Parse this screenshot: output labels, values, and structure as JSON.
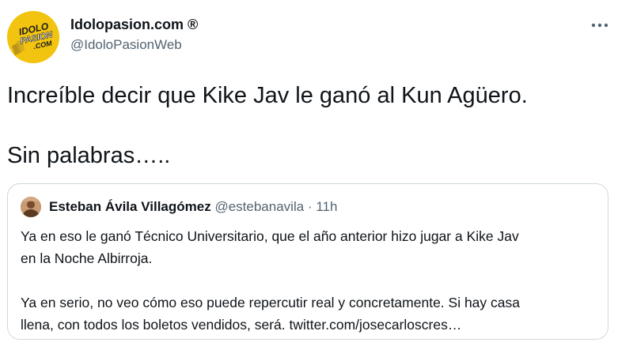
{
  "author": {
    "display_name": "Idolopasion.com ®",
    "handle": "@IdoloPasionWeb",
    "avatar_icon": "idolopasion-logo-icon",
    "avatar_logo_lines": [
      "IDOLO",
      "PASION",
      ".COM"
    ]
  },
  "more_icon": "more-horizontal-icon",
  "tweet": {
    "line1": "Increíble decir que Kike Jav le ganó al Kun Agüero.",
    "line2": "Sin palabras….."
  },
  "quote": {
    "display_name": "Esteban Ávila Villagómez",
    "handle": "@estebanavila",
    "separator": "·",
    "time": "11h",
    "avatar_icon": "user-avatar-icon",
    "para1_line1": "Ya en eso le ganó Técnico Universitario, que el año anterior hizo jugar a Kike Jav",
    "para1_line2": "en la Noche Albirroja.",
    "para2_line1": "Ya en serio, no veo cómo eso puede repercutir real y concretamente. Si hay casa",
    "para2_line2": "llena, con todos los boletos vendidos, será. twitter.com/josecarloscres…"
  },
  "colors": {
    "text": "#0f1419",
    "secondary": "#536471",
    "border": "#cfd9de",
    "avatar_bg": "#f2c40f"
  }
}
